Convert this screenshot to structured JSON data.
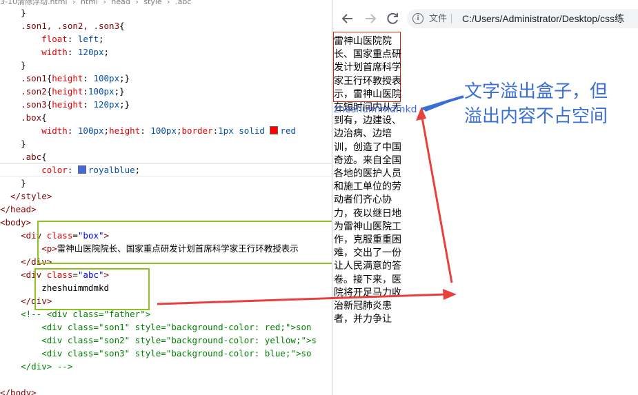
{
  "editor": {
    "breadcrumb": [
      "3-10清除浮动.html",
      "html",
      "head",
      "style",
      ".abc"
    ],
    "lines": [
      [
        [
          "t-punc",
          "    }"
        ]
      ],
      [
        [
          "t-sel",
          "    .son1, .son2, .son3"
        ],
        [
          "t-punc",
          "{"
        ]
      ],
      [
        [
          "t-prop",
          "        float"
        ],
        [
          "t-punc",
          ": "
        ],
        [
          "t-val",
          "left"
        ],
        [
          "t-punc",
          ";"
        ]
      ],
      [
        [
          "t-prop",
          "        width"
        ],
        [
          "t-punc",
          ": "
        ],
        [
          "t-val",
          "120px"
        ],
        [
          "t-punc",
          ";"
        ]
      ],
      [
        [
          "t-punc",
          "    }"
        ]
      ],
      [
        [
          "t-sel",
          "    .son1"
        ],
        [
          "t-punc",
          "{"
        ],
        [
          "t-prop",
          "height"
        ],
        [
          "t-punc",
          ": "
        ],
        [
          "t-val",
          "100px"
        ],
        [
          "t-punc",
          ";}"
        ]
      ],
      [
        [
          "t-sel",
          "    .son2"
        ],
        [
          "t-punc",
          "{"
        ],
        [
          "t-prop",
          "height"
        ],
        [
          "t-punc",
          ":"
        ],
        [
          "t-val",
          "100px"
        ],
        [
          "t-punc",
          ";}"
        ]
      ],
      [
        [
          "t-sel",
          "    .son3"
        ],
        [
          "t-punc",
          "{"
        ],
        [
          "t-prop",
          "height"
        ],
        [
          "t-punc",
          ": "
        ],
        [
          "t-val",
          "120px"
        ],
        [
          "t-punc",
          ";}"
        ]
      ],
      [
        [
          "t-sel",
          "    .box"
        ],
        [
          "t-punc",
          "{"
        ]
      ],
      [
        [
          "t-prop",
          "        width"
        ],
        [
          "t-punc",
          ": "
        ],
        [
          "t-val",
          "100px"
        ],
        [
          "t-punc",
          ";"
        ],
        [
          "t-prop",
          "height"
        ],
        [
          "t-punc",
          ": "
        ],
        [
          "t-val",
          "100px"
        ],
        [
          "t-punc",
          ";"
        ],
        [
          "t-prop",
          "border"
        ],
        [
          "t-punc",
          ":"
        ],
        [
          "t-val",
          "1px solid "
        ],
        [
          "swatch:#ff0000",
          ""
        ],
        [
          "t-val",
          "red"
        ]
      ],
      [
        [
          "t-punc",
          "    }"
        ]
      ],
      [
        [
          "t-sel",
          "    .abc"
        ],
        [
          "t-punc",
          "{"
        ]
      ],
      [
        [
          "t-prop",
          "        color"
        ],
        [
          "t-punc",
          ": "
        ],
        [
          "swatch:#4169e1",
          ""
        ],
        [
          "t-val",
          "royalblue"
        ],
        [
          "t-punc",
          ";"
        ]
      ],
      [
        [
          "t-punc",
          "    }"
        ]
      ],
      [
        [
          "t-tag",
          "  </style>"
        ]
      ],
      [
        [
          "t-tag",
          "</head>"
        ]
      ],
      [
        [
          "t-tag",
          "<body>"
        ]
      ],
      [
        [
          "t-tag",
          "    <div "
        ],
        [
          "t-attr",
          "class"
        ],
        [
          "t-punc",
          "="
        ],
        [
          "t-str",
          "\"box\""
        ],
        [
          "t-tag",
          ">"
        ]
      ],
      [
        [
          "t-tag",
          "        <p>"
        ],
        [
          "t-text",
          "雷神山医院院长、国家重点研发计划首席科学家王行环教授表示"
        ]
      ],
      [
        [
          "t-tag",
          "    </div>"
        ]
      ],
      [
        [
          "t-tag",
          "    <div "
        ],
        [
          "t-attr",
          "class"
        ],
        [
          "t-punc",
          "="
        ],
        [
          "t-str",
          "\"abc\""
        ],
        [
          "t-tag",
          ">"
        ]
      ],
      [
        [
          "t-text",
          "        zheshuimmdmkd"
        ]
      ],
      [
        [
          "t-tag",
          "    </div>"
        ]
      ],
      [
        [
          "t-com",
          "    <!-- <div class=\"father\">"
        ]
      ],
      [
        [
          "t-com",
          "        <div class=\"son1\" style=\"background-color: red;\">son"
        ]
      ],
      [
        [
          "t-com",
          "        <div class=\"son2\" style=\"background-color: yellow;\">s"
        ]
      ],
      [
        [
          "t-com",
          "        <div class=\"son3\" style=\"background-color: blue;\">so"
        ]
      ],
      [
        [
          "t-com",
          "    </div> -->"
        ]
      ],
      [
        [
          "t-punc",
          ""
        ]
      ],
      [
        [
          "t-tag",
          "</body>"
        ]
      ]
    ]
  },
  "browser": {
    "back_icon": "arrow-left-icon",
    "forward_icon": "arrow-right-icon",
    "reload_icon": "reload-icon",
    "info_icon": "info-icon",
    "file_label": "文件",
    "url": "C:/Users/Administrator/Desktop/css练",
    "box_text": "雷神山医院院长、国家重点研发计划首席科学家王行环教授表示，雷神山医院在短时间内从无到有，边建设、边治病、边培训，创造了中国奇迹。来自全国各地的医护人员和施工单位的劳动者们齐心协力，夜以继日地为雷神山医院工作，克服重重困难，交出了一份让人民满意的答卷。接下来，医院将开足马力收治新冠肺炎患者，并力争让",
    "abc_text": "zheshuimmdmkd"
  },
  "annotation": {
    "line1": "文字溢出盒子，但",
    "line2": "溢出内容不占空间",
    "color": "#3a6fd6"
  },
  "colors": {
    "highlight_green": "#8dc21f",
    "arrow_red": "#e8413d",
    "arrow_blue": "#3a6fd6"
  }
}
